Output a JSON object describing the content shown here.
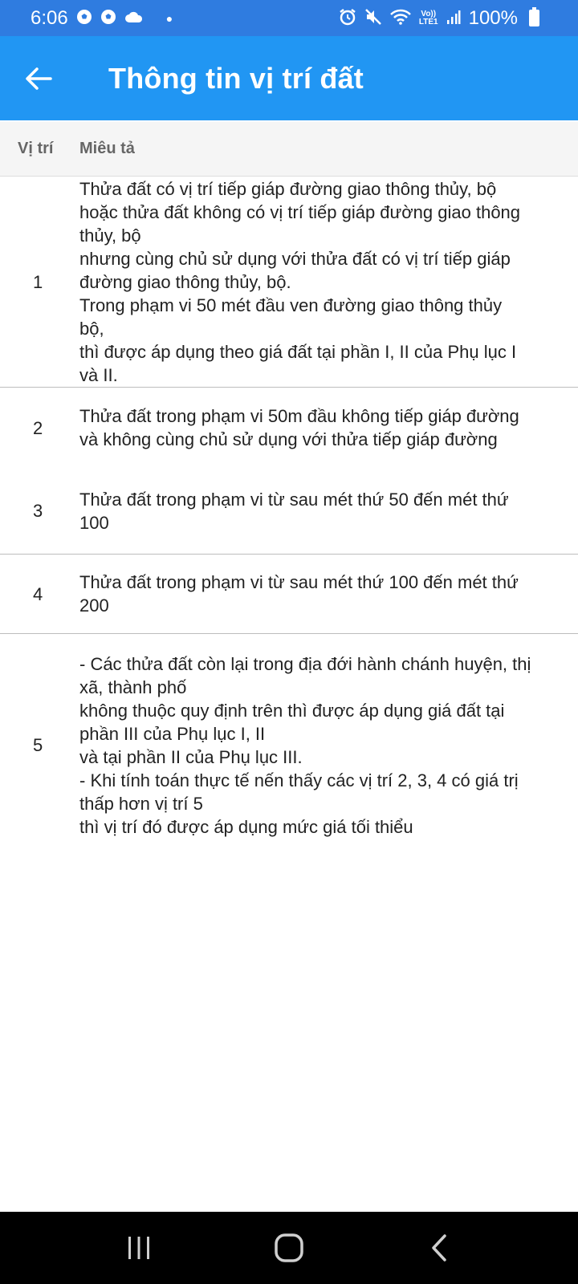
{
  "status_bar": {
    "time": "6:06",
    "left_icons": [
      "soccer-ball-icon",
      "soccer-ball-icon",
      "cloud-icon",
      "dot-icon"
    ],
    "right_icons": [
      "alarm-icon",
      "mute-icon",
      "wifi-icon",
      "volte-icon",
      "signal-icon",
      "battery-icon"
    ],
    "volte_top": "Vo))",
    "volte_bottom": "LTE1",
    "battery": "100%"
  },
  "app_bar": {
    "title": "Thông tin vị trí đất",
    "back_icon": "arrow-left-icon",
    "background": "#2196F3"
  },
  "table": {
    "headers": {
      "position": "Vị trí",
      "description": "Miêu tả"
    },
    "rows": [
      {
        "position": "1",
        "lines": [
          "Thửa đất có vị trí tiếp giáp đường giao thông thủy, bộ",
          "hoặc thửa đất không có vị trí tiếp giáp đường giao thông",
          "thủy, bộ",
          "nhưng cùng chủ sử dụng với thửa đất có vị trí tiếp giáp",
          "đường giao thông thủy, bộ.",
          "Trong phạm vi 50 mét đầu ven đường giao thông thủy",
          "bộ,",
          "thì được áp dụng theo giá đất tại phần I, II của Phụ lục I",
          "và II."
        ]
      },
      {
        "position": "2",
        "lines": [
          "Thửa đất trong phạm vi 50m đầu không tiếp giáp đường",
          "và không cùng chủ sử dụng với thửa tiếp giáp đường"
        ]
      },
      {
        "position": "3",
        "lines": [
          "Thửa đất trong phạm vi từ sau mét thứ 50 đến mét thứ",
          "100"
        ]
      },
      {
        "position": "4",
        "lines": [
          "Thửa đất trong phạm vi từ sau mét thứ 100 đến mét thứ",
          "200"
        ]
      },
      {
        "position": "5",
        "lines": [
          "- Các thửa đất còn lại trong địa đới hành chánh huyện, thị",
          "xã, thành phố",
          "không thuộc quy định trên thì được áp dụng giá đất tại",
          "phần III của Phụ lục I, II",
          "và tại phần II của Phụ lục III.",
          "- Khi tính toán thực tế nến thấy các vị trí 2, 3, 4 có giá trị",
          "thấp hơn vị trí 5",
          "thì vị trí đó được áp dụng mức giá tối thiểu"
        ]
      }
    ]
  },
  "nav_bar": {
    "buttons": [
      "recent-apps-icon",
      "home-icon",
      "back-icon"
    ]
  }
}
